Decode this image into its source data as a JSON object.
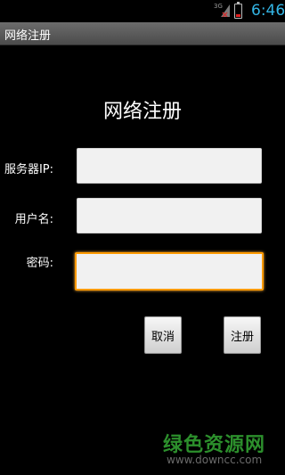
{
  "status_bar": {
    "network": "3G",
    "time": "6:46"
  },
  "title_bar": {
    "title": "网络注册"
  },
  "form": {
    "heading": "网络注册",
    "server_ip_label": "服务器IP:",
    "server_ip_value": "",
    "username_label": "用户名:",
    "username_value": "",
    "password_label": "密码:",
    "password_value": ""
  },
  "buttons": {
    "cancel_label": "取消",
    "register_label": "注册"
  },
  "watermark": {
    "brand": "绿色资源网",
    "url": "www.downcc.com"
  },
  "colors": {
    "clock": "#33b5e5",
    "focus_border": "#ff9a00",
    "watermark": "#2c8f2c"
  }
}
